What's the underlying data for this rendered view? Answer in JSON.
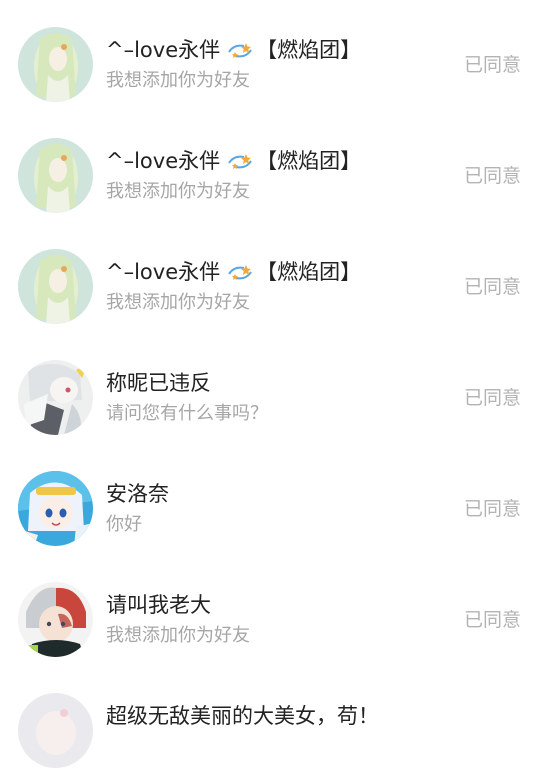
{
  "requests": [
    {
      "name_prefix": "^–love永伴",
      "name_suffix": "【燃焰团】",
      "badge_icon": "rotating-stars-icon",
      "message": "我想添加你为好友",
      "status": "已同意",
      "avatar": "anime-girl-green-hair"
    },
    {
      "name_prefix": "^–love永伴",
      "name_suffix": "【燃焰团】",
      "badge_icon": "rotating-stars-icon",
      "message": "我想添加你为好友",
      "status": "已同意",
      "avatar": "anime-girl-green-hair"
    },
    {
      "name_prefix": "^–love永伴",
      "name_suffix": "【燃焰团】",
      "badge_icon": "rotating-stars-icon",
      "message": "我想添加你为好友",
      "status": "已同意",
      "avatar": "anime-girl-green-hair"
    },
    {
      "name_prefix": "称昵已违反",
      "name_suffix": "",
      "badge_icon": "",
      "message": "请问您有什么事吗？",
      "status": "已同意",
      "avatar": "anime-girl-silver-hair"
    },
    {
      "name_prefix": "安洛奈",
      "name_suffix": "",
      "badge_icon": "",
      "message": "你好",
      "status": "已同意",
      "avatar": "anime-girl-blue-background"
    },
    {
      "name_prefix": "请叫我老大",
      "name_suffix": "",
      "badge_icon": "",
      "message": "我想添加你为好友",
      "status": "已同意",
      "avatar": "anime-boy-red-white-hair"
    },
    {
      "name_prefix": "超级无敌美丽的大美女，苟！",
      "name_suffix": "",
      "badge_icon": "",
      "message": "",
      "status": "",
      "avatar": "anime-girl-pale"
    }
  ],
  "colors": {
    "name": "#222222",
    "message": "#a6a6a6",
    "status": "#b3b3b3",
    "background": "#ffffff"
  }
}
